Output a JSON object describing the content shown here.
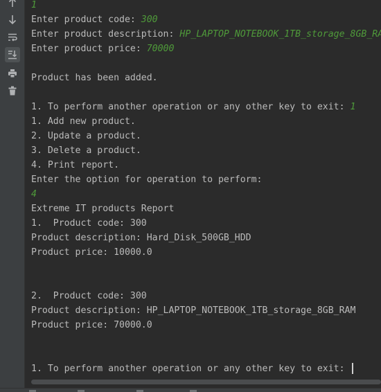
{
  "toolbar": {
    "icons": [
      "scroll-up-icon",
      "scroll-down-icon",
      "soft-wrap-icon",
      "scroll-to-end-icon",
      "print-icon",
      "clear-all-icon"
    ]
  },
  "console": {
    "lines": [
      {
        "text": "",
        "input": "1"
      },
      {
        "text": "Enter product code: ",
        "input": "300"
      },
      {
        "text": "Enter product description: ",
        "input": "HP_LAPTOP_NOTEBOOK_1TB_storage_8GB_RA"
      },
      {
        "text": "Enter product price: ",
        "input": "70000"
      },
      {
        "text": "",
        "input": ""
      },
      {
        "text": "Product has been added.",
        "input": ""
      },
      {
        "text": "",
        "input": ""
      },
      {
        "text": "1. To perform another operation or any other key to exit: ",
        "input": "1"
      },
      {
        "text": "1. Add new product.",
        "input": ""
      },
      {
        "text": "2. Update a product.",
        "input": ""
      },
      {
        "text": "3. Delete a product.",
        "input": ""
      },
      {
        "text": "4. Print report.",
        "input": ""
      },
      {
        "text": "Enter the option for operation to perform:",
        "input": ""
      },
      {
        "text": "",
        "input": "4"
      },
      {
        "text": "Extreme IT products Report",
        "input": ""
      },
      {
        "text": "1.  Product code: 300",
        "input": ""
      },
      {
        "text": "Product description: Hard_Disk_500GB_HDD",
        "input": ""
      },
      {
        "text": "Product price: 10000.0",
        "input": ""
      },
      {
        "text": "",
        "input": ""
      },
      {
        "text": "",
        "input": ""
      },
      {
        "text": "2.  Product code: 300",
        "input": ""
      },
      {
        "text": "Product description: HP_LAPTOP_NOTEBOOK_1TB_storage_8GB_RAM",
        "input": ""
      },
      {
        "text": "Product price: 70000.0",
        "input": ""
      },
      {
        "text": "",
        "input": ""
      },
      {
        "text": "",
        "input": ""
      },
      {
        "text": "1. To perform another operation or any other key to exit: ",
        "input": ""
      }
    ]
  }
}
